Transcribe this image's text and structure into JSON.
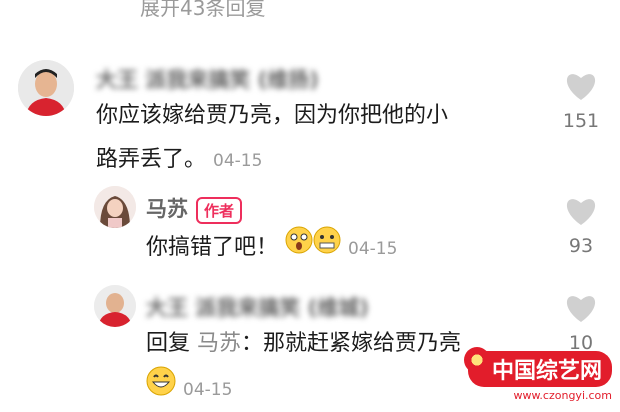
{
  "top_line": "展开43条回复",
  "comments": [
    {
      "name": "大王 派我来搞笑 (维扬)",
      "text_line1": "你应该嫁给贾乃亮，因为你把他的小",
      "text_line2": "路弄丢了。",
      "date": "04-15",
      "likes": "151"
    },
    {
      "name": "马苏",
      "author_tag": "作者",
      "text": "你搞错了吧！",
      "date": "04-15",
      "likes": "93"
    },
    {
      "name": "大王 派我来搞笑 (维城)",
      "reply_prefix": "回复",
      "reply_target": "马苏",
      "reply_text": "：那就赶紧嫁给贾乃亮",
      "date": "04-15",
      "likes": "10"
    }
  ],
  "watermark": {
    "main": "中国综艺网",
    "url": "www.czongyi.com"
  },
  "colors": {
    "accent": "#ee2e5c",
    "muted": "#9a9a9a",
    "like": "#cfcfcf"
  }
}
